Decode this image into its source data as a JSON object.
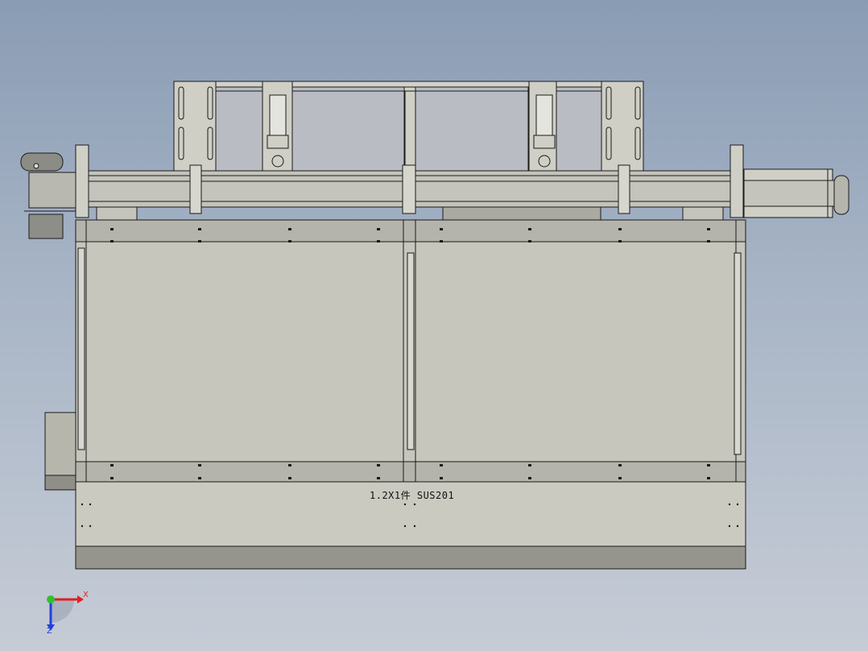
{
  "viewport": {
    "annotation": "1.2X1件 SUS201",
    "triad": {
      "x_label": "X",
      "z_label": "Z"
    }
  },
  "colors": {
    "background_top": "#8a9cb4",
    "background_bottom": "#c6ccd6",
    "part_face": "#c8c8be",
    "part_shade": "#9a9a92",
    "edge": "#1a1a1a"
  }
}
